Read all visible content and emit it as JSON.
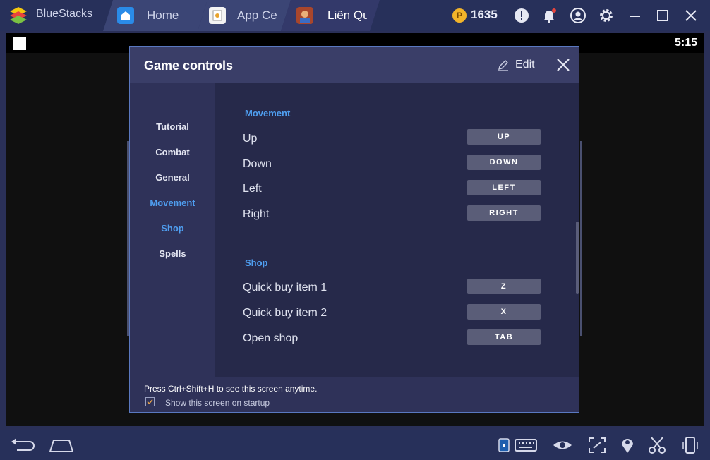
{
  "titlebar": {
    "app_name": "BlueStacks",
    "tabs": [
      {
        "label": "Home"
      },
      {
        "label": "App Ce"
      },
      {
        "label": "Liên Qu"
      }
    ],
    "coin_symbol": "P",
    "coin_count": "1635",
    "icons": [
      "alert-icon",
      "bell-icon",
      "account-icon",
      "gear-icon",
      "minimize-icon",
      "maximize-icon",
      "close-window-icon"
    ]
  },
  "screen": {
    "clock": "5:15"
  },
  "dialog": {
    "title": "Game controls",
    "edit_label": "Edit",
    "nav": [
      {
        "label": "Tutorial",
        "active": false
      },
      {
        "label": "Combat",
        "active": false
      },
      {
        "label": "General",
        "active": false
      },
      {
        "label": "Movement",
        "active": true
      },
      {
        "label": "Shop",
        "active": true
      },
      {
        "label": "Spells",
        "active": false
      }
    ],
    "sections": [
      {
        "title": "Movement",
        "rows": [
          {
            "label": "Up",
            "key": "UP"
          },
          {
            "label": "Down",
            "key": "DOWN"
          },
          {
            "label": "Left",
            "key": "LEFT"
          },
          {
            "label": "Right",
            "key": "RIGHT"
          }
        ]
      },
      {
        "title": "Shop",
        "rows": [
          {
            "label": "Quick buy item 1",
            "key": "Z"
          },
          {
            "label": "Quick buy item 2",
            "key": "X"
          },
          {
            "label": "Open shop",
            "key": "TAB"
          }
        ]
      }
    ],
    "footer_hint": "Press Ctrl+Shift+H to see this screen anytime.",
    "startup_label": "Show this screen on startup",
    "startup_checked": true
  },
  "bottombar": {
    "icons": [
      "back-icon",
      "home-icon",
      "keymap-icon",
      "keyboard-icon",
      "eye-icon",
      "fullscreen-icon",
      "location-icon",
      "scissors-icon",
      "phone-rotate-icon"
    ]
  },
  "colors": {
    "accent": "#4f9ef0",
    "coin": "#f2b42a"
  }
}
